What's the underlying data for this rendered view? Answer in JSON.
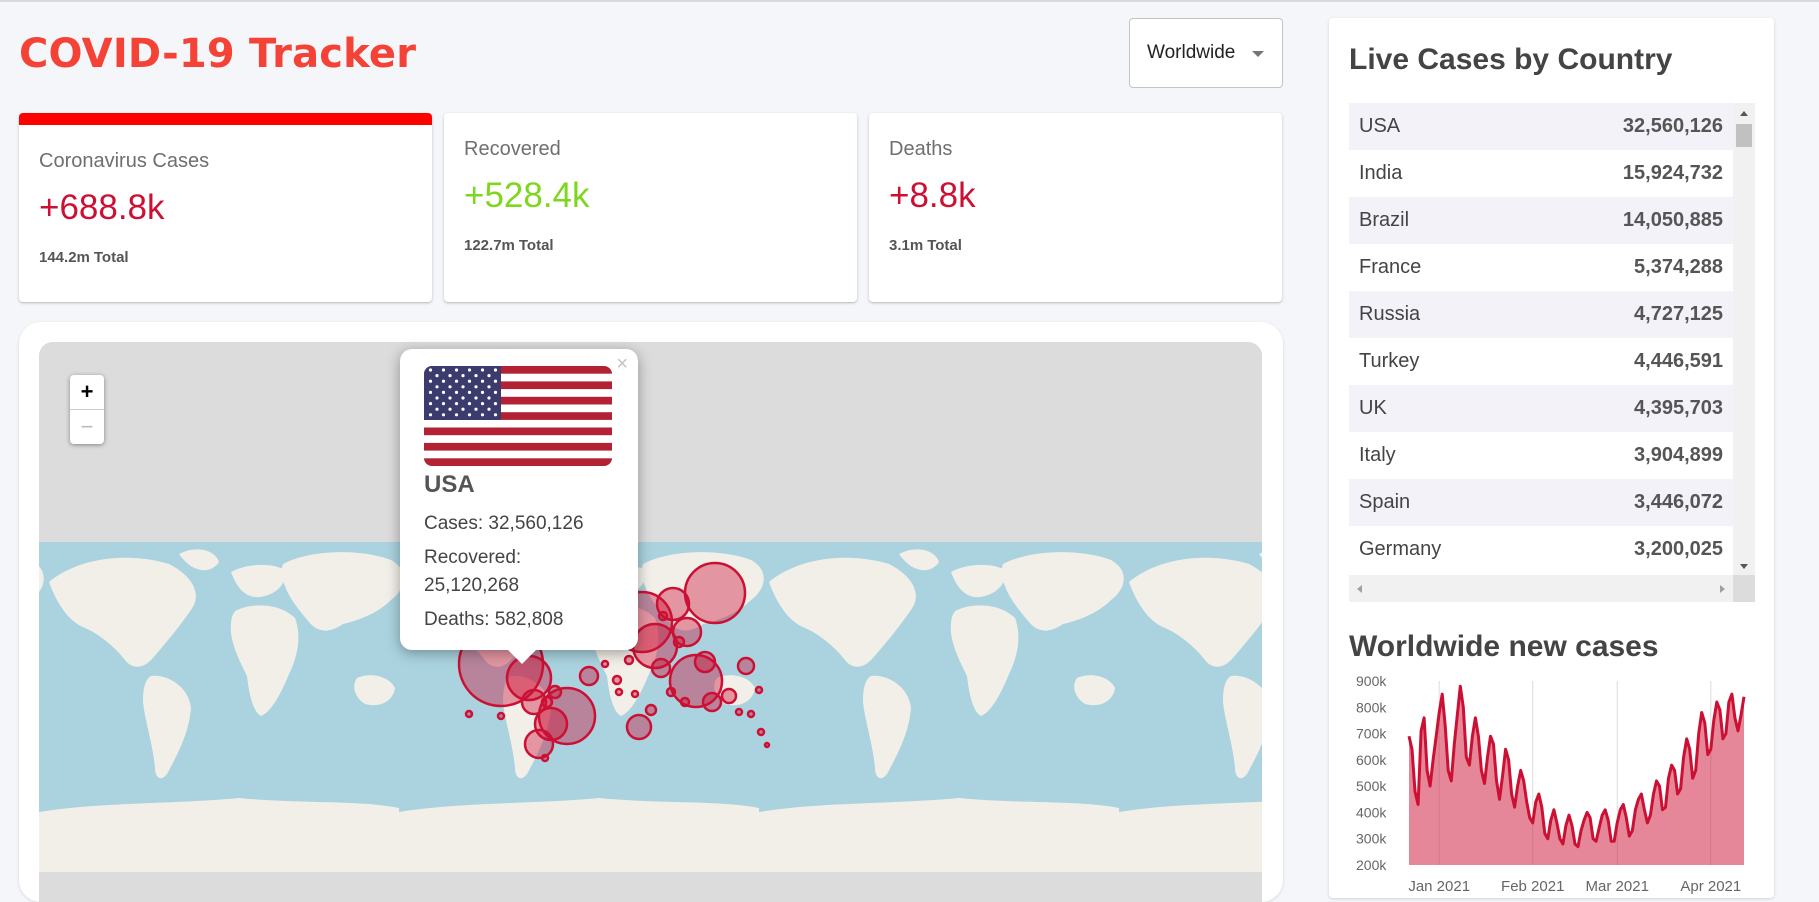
{
  "app": {
    "title": "COVID-19 Tracker"
  },
  "country_select": {
    "selected": "Worldwide"
  },
  "stats": [
    {
      "label": "Coronavirus Cases",
      "value": "+688.8k",
      "total": "144.2m",
      "total_suffix": "Total",
      "color": "#cc1034",
      "selected": true
    },
    {
      "label": "Recovered",
      "value": "+528.4k",
      "total": "122.7m",
      "total_suffix": "Total",
      "color": "#7dd71d",
      "selected": false
    },
    {
      "label": "Deaths",
      "value": "+8.8k",
      "total": "3.1m",
      "total_suffix": "Total",
      "color": "#cc1034",
      "selected": false
    }
  ],
  "map": {
    "zoom_in": "+",
    "zoom_out": "−",
    "popup": {
      "close": "×",
      "flag_icon": "usa-flag-icon",
      "country": "USA",
      "cases": "Cases: 32,560,126",
      "recovered_label": "Recovered:",
      "recovered_value": "25,120,268",
      "deaths": "Deaths: 582,808"
    },
    "colors": {
      "ocean": "#aad3df",
      "land": "#f2efe9",
      "circle": "#cc1034"
    }
  },
  "live_cases": {
    "title": "Live Cases by Country",
    "rows": [
      {
        "country": "USA",
        "cases": "32,560,126"
      },
      {
        "country": "India",
        "cases": "15,924,732"
      },
      {
        "country": "Brazil",
        "cases": "14,050,885"
      },
      {
        "country": "France",
        "cases": "5,374,288"
      },
      {
        "country": "Russia",
        "cases": "4,727,125"
      },
      {
        "country": "Turkey",
        "cases": "4,446,591"
      },
      {
        "country": "UK",
        "cases": "4,395,703"
      },
      {
        "country": "Italy",
        "cases": "3,904,899"
      },
      {
        "country": "Spain",
        "cases": "3,446,072"
      },
      {
        "country": "Germany",
        "cases": "3,200,025"
      }
    ]
  },
  "new_cases": {
    "title": "Worldwide new cases"
  },
  "chart_data": {
    "type": "area",
    "title": "",
    "xlabel": "",
    "ylabel": "",
    "ylim": [
      200000,
      900000
    ],
    "y_ticks": [
      {
        "value": 900000,
        "label": "900k"
      },
      {
        "value": 800000,
        "label": "800k"
      },
      {
        "value": 700000,
        "label": "700k"
      },
      {
        "value": 600000,
        "label": "600k"
      },
      {
        "value": 500000,
        "label": "500k"
      },
      {
        "value": 400000,
        "label": "400k"
      },
      {
        "value": 300000,
        "label": "300k"
      },
      {
        "value": 200000,
        "label": "200k"
      }
    ],
    "x_ticks": [
      "Jan 2021",
      "Feb 2021",
      "Mar 2021",
      "Apr 2021"
    ],
    "x_tick_index": [
      10,
      41,
      69,
      100
    ],
    "line_color": "#cc1034",
    "fill_color": "rgba(204,16,52,0.5)",
    "values": [
      690000,
      640000,
      480000,
      430000,
      710000,
      760000,
      560000,
      500000,
      600000,
      690000,
      780000,
      850000,
      730000,
      560000,
      520000,
      660000,
      770000,
      880000,
      800000,
      610000,
      580000,
      690000,
      760000,
      690000,
      560000,
      510000,
      610000,
      690000,
      660000,
      520000,
      450000,
      540000,
      640000,
      600000,
      470000,
      420000,
      500000,
      560000,
      520000,
      440000,
      380000,
      360000,
      440000,
      470000,
      420000,
      320000,
      300000,
      370000,
      410000,
      360000,
      300000,
      280000,
      350000,
      390000,
      350000,
      280000,
      270000,
      330000,
      370000,
      400000,
      380000,
      300000,
      290000,
      340000,
      390000,
      410000,
      370000,
      290000,
      290000,
      360000,
      410000,
      430000,
      380000,
      310000,
      330000,
      410000,
      450000,
      470000,
      410000,
      360000,
      390000,
      470000,
      520000,
      500000,
      410000,
      420000,
      530000,
      580000,
      560000,
      470000,
      490000,
      610000,
      680000,
      640000,
      530000,
      560000,
      700000,
      780000,
      740000,
      620000,
      640000,
      750000,
      820000,
      790000,
      680000,
      700000,
      820000,
      850000,
      760000,
      710000,
      770000,
      840000
    ]
  }
}
